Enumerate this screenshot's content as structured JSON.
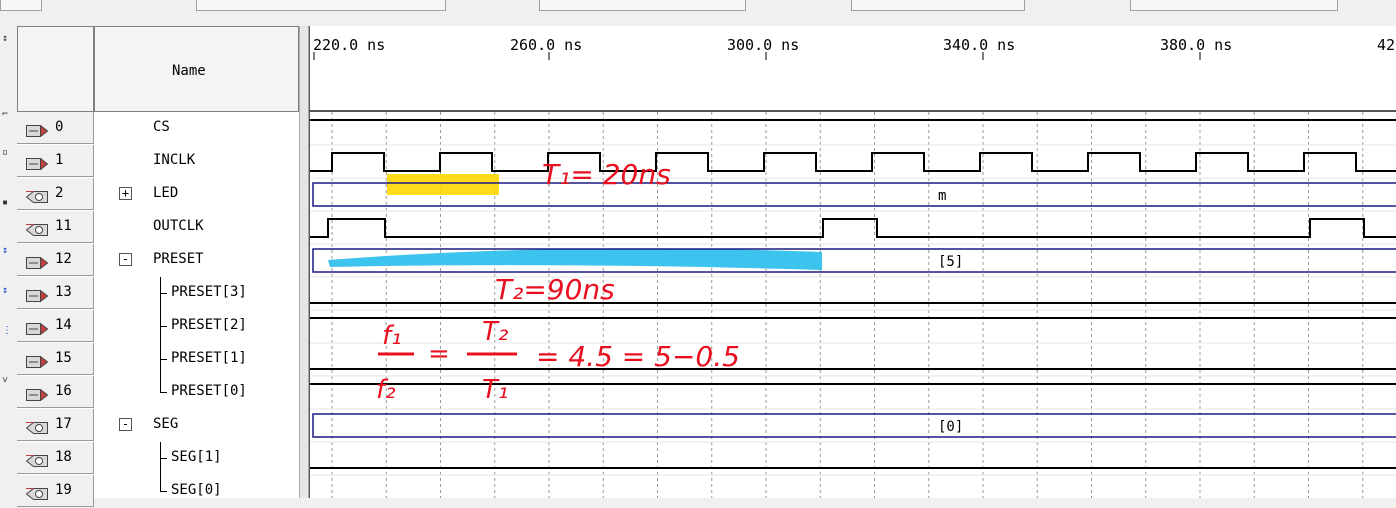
{
  "names_header": "Name",
  "time_ticks": [
    "220.0 ns",
    "260.0 ns",
    "300.0 ns",
    "340.0 ns",
    "380.0 ns",
    "42"
  ],
  "signals": [
    {
      "id": "0",
      "name": "CS",
      "pin": "input",
      "indent": 0,
      "expander": ""
    },
    {
      "id": "1",
      "name": "INCLK",
      "pin": "input",
      "indent": 0,
      "expander": ""
    },
    {
      "id": "2",
      "name": "LED",
      "pin": "output",
      "indent": 0,
      "expander": "+"
    },
    {
      "id": "11",
      "name": "OUTCLK",
      "pin": "output",
      "indent": 0,
      "expander": ""
    },
    {
      "id": "12",
      "name": "PRESET",
      "pin": "input",
      "indent": 0,
      "expander": "-"
    },
    {
      "id": "13",
      "name": "PRESET[3]",
      "pin": "input",
      "indent": 1,
      "expander": ""
    },
    {
      "id": "14",
      "name": "PRESET[2]",
      "pin": "input",
      "indent": 1,
      "expander": ""
    },
    {
      "id": "15",
      "name": "PRESET[1]",
      "pin": "input",
      "indent": 1,
      "expander": ""
    },
    {
      "id": "16",
      "name": "PRESET[0]",
      "pin": "input",
      "indent": 1,
      "expander": ""
    },
    {
      "id": "17",
      "name": "SEG",
      "pin": "output",
      "indent": 0,
      "expander": "-"
    },
    {
      "id": "18",
      "name": "SEG[1]",
      "pin": "output",
      "indent": 1,
      "expander": ""
    },
    {
      "id": "19",
      "name": "SEG[0]",
      "pin": "output",
      "indent": 1,
      "expander": ""
    }
  ],
  "bus_values": {
    "LED": "m",
    "PRESET": "[5]",
    "SEG": "[0]"
  },
  "annotations": {
    "t1": "T₁= 20ns",
    "t2": "T₂=90ns",
    "formula_f1": "f₁",
    "formula_f2": "f₂",
    "formula_T2": "T₂",
    "formula_T1": "T₁",
    "formula_rhs": "= 4.5 = 5−0.5"
  },
  "colors": {
    "highlight_yellow": "#ffd800",
    "highlight_cyan": "#3cc3ee",
    "annotation_red": "#e8101e",
    "bus_outline": "#1a1a80",
    "grid": "#9a9a9a"
  }
}
